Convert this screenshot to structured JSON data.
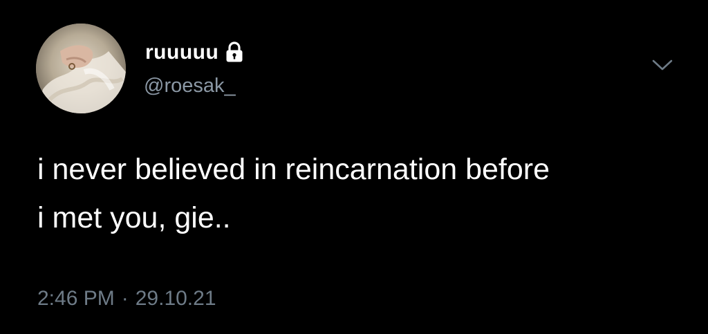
{
  "author": {
    "display_name": "ruuuuu",
    "handle": "@roesak_",
    "protected": true,
    "avatar_icon": "avatar-photo"
  },
  "tweet": {
    "text": "i never believed in reincarnation before\ni met you, gie..",
    "time": "2:46 PM",
    "separator": "·",
    "date": "29.10.21"
  },
  "icons": {
    "lock": "lock-icon",
    "more": "chevron-down-icon"
  },
  "colors": {
    "background": "#000000",
    "text": "#ffffff",
    "secondary_text": "#8b98a5",
    "timestamp": "#6e7b87"
  }
}
